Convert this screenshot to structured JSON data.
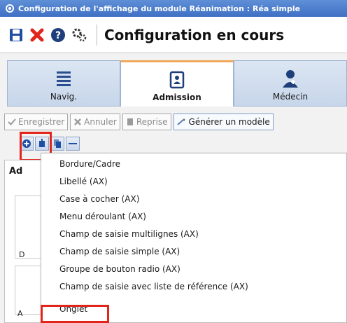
{
  "window": {
    "title": "Configuration de l'affichage du module Réanimation : Réa simple"
  },
  "toolbar": {
    "heading": "Configuration en cours",
    "icons": [
      "save-icon",
      "close-icon",
      "help-icon",
      "settings-icon"
    ]
  },
  "module_tabs": [
    {
      "label": "Navig.",
      "icon": "list-icon"
    },
    {
      "label": "Admission",
      "icon": "admission-icon"
    },
    {
      "label": "Médecin",
      "icon": "doctor-icon"
    }
  ],
  "actions": {
    "save": "Enregistrer",
    "cancel": "Annuler",
    "resume": "Reprise",
    "generate": "Générer un modèle"
  },
  "panel": {
    "header": "Ad",
    "label_d": "D",
    "label_a": "A"
  },
  "menu": {
    "items": [
      "Bordure/Cadre",
      "Libellé (AX)",
      "Case à cocher (AX)",
      "Menu déroulant (AX)",
      "Champ de saisie multilignes (AX)",
      "Champ de saisie simple (AX)",
      "Groupe de bouton radio (AX)",
      "Champ de saisie avec liste de référence (AX)",
      "Onglet"
    ]
  },
  "colors": {
    "accent": "#3f70c4",
    "highlight": "#e1251b",
    "active_tab_top": "#f0a95a"
  }
}
